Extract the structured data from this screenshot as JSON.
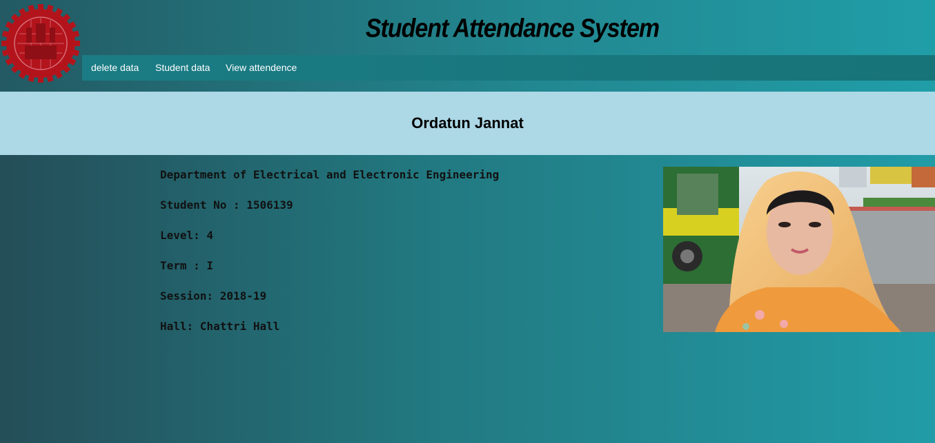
{
  "header": {
    "title": "Student Attendance System",
    "logo_icon": "university-emblem-icon"
  },
  "nav": {
    "items": [
      {
        "label": "delete data"
      },
      {
        "label": "Student data"
      },
      {
        "label": "View attendence"
      }
    ]
  },
  "student": {
    "name": "Ordatun Jannat",
    "department": "Department of Electrical and Electronic Engineering",
    "student_no": "Student No : 1506139",
    "level": "Level: 4",
    "term": "Term : I",
    "session": "Session: 2018-19",
    "hall": "Hall: Chattri Hall",
    "photo_icon": "student-photo"
  },
  "colors": {
    "banner": "#add8e6",
    "nav_bg": "#1b7c85",
    "logo_red": "#b3141c",
    "background_dark": "#244e58",
    "background_light": "#219ca7"
  }
}
